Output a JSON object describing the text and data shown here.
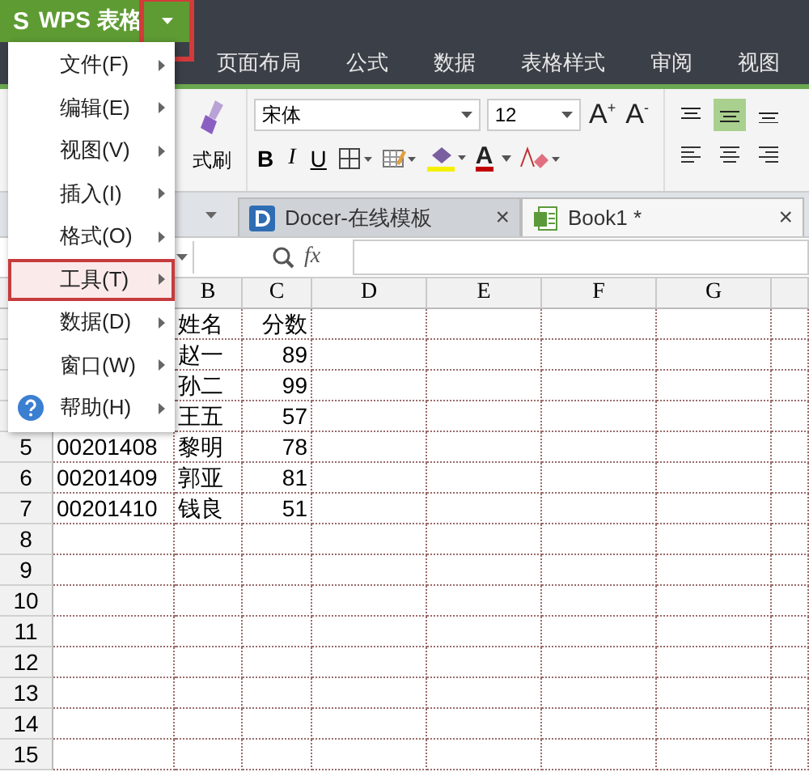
{
  "app_button": {
    "label": "WPS 表格",
    "logo": "S",
    "dropdown_highlighted": true
  },
  "ribbon_tabs": [
    {
      "label": "页面布局"
    },
    {
      "label": "公式"
    },
    {
      "label": "数据"
    },
    {
      "label": "表格样式"
    },
    {
      "label": "审阅"
    },
    {
      "label": "视图"
    }
  ],
  "ribbon": {
    "format_painter": "式刷",
    "font": "宋体",
    "font_size": "12",
    "grow_font": "A$^{+}$",
    "shrink_font": "A$^{-}$",
    "bold": "B",
    "italic": "I",
    "underline": "U",
    "font_color": "A",
    "alignments": [
      {
        "selected": false
      },
      {
        "selected": true
      },
      {
        "selected": false
      }
    ]
  },
  "doc_tabs": [
    {
      "label": "Docer-在线模板",
      "selected": false,
      "close": "×"
    },
    {
      "label": "Book1 *",
      "selected": true,
      "close": "×"
    }
  ],
  "formula_bar": {
    "fx": "fx"
  },
  "columns": [
    {
      "label": "B"
    },
    {
      "label": "C"
    },
    {
      "label": "D"
    },
    {
      "label": "E"
    },
    {
      "label": "F"
    },
    {
      "label": "G"
    }
  ],
  "rows": [
    {
      "B": "姓名",
      "C": "分数"
    },
    {
      "B": "赵一",
      "C": "89"
    },
    {
      "B": "孙二",
      "C": "99"
    },
    {
      "B": "王五",
      "C": "57"
    },
    {
      "number": "5",
      "A": "00201408",
      "B": "黎明",
      "C": "78"
    },
    {
      "number": "6",
      "A": "00201409",
      "B": "郭亚",
      "C": "81"
    },
    {
      "number": "7",
      "A": "00201410",
      "B": "钱良",
      "C": "51"
    },
    {
      "number": "8"
    },
    {
      "number": "9"
    },
    {
      "number": "10"
    },
    {
      "number": "11"
    },
    {
      "number": "12"
    },
    {
      "number": "13"
    },
    {
      "number": "14"
    },
    {
      "number": "15"
    }
  ],
  "menu": [
    {
      "label": "文件(F)",
      "kind": "plain",
      "highlighted": false
    },
    {
      "label": "编辑(E)",
      "kind": "plain",
      "highlighted": false
    },
    {
      "label": "视图(V)",
      "kind": "plain",
      "highlighted": false
    },
    {
      "label": "插入(I)",
      "kind": "plain",
      "highlighted": false
    },
    {
      "label": "格式(O)",
      "kind": "plain",
      "highlighted": false
    },
    {
      "label": "工具(T)",
      "kind": "plain",
      "highlighted": true
    },
    {
      "label": "数据(D)",
      "kind": "plain",
      "highlighted": false
    },
    {
      "label": "窗口(W)",
      "kind": "plain",
      "highlighted": false
    },
    {
      "label": "帮助(H)",
      "kind": "help",
      "highlighted": false
    }
  ]
}
